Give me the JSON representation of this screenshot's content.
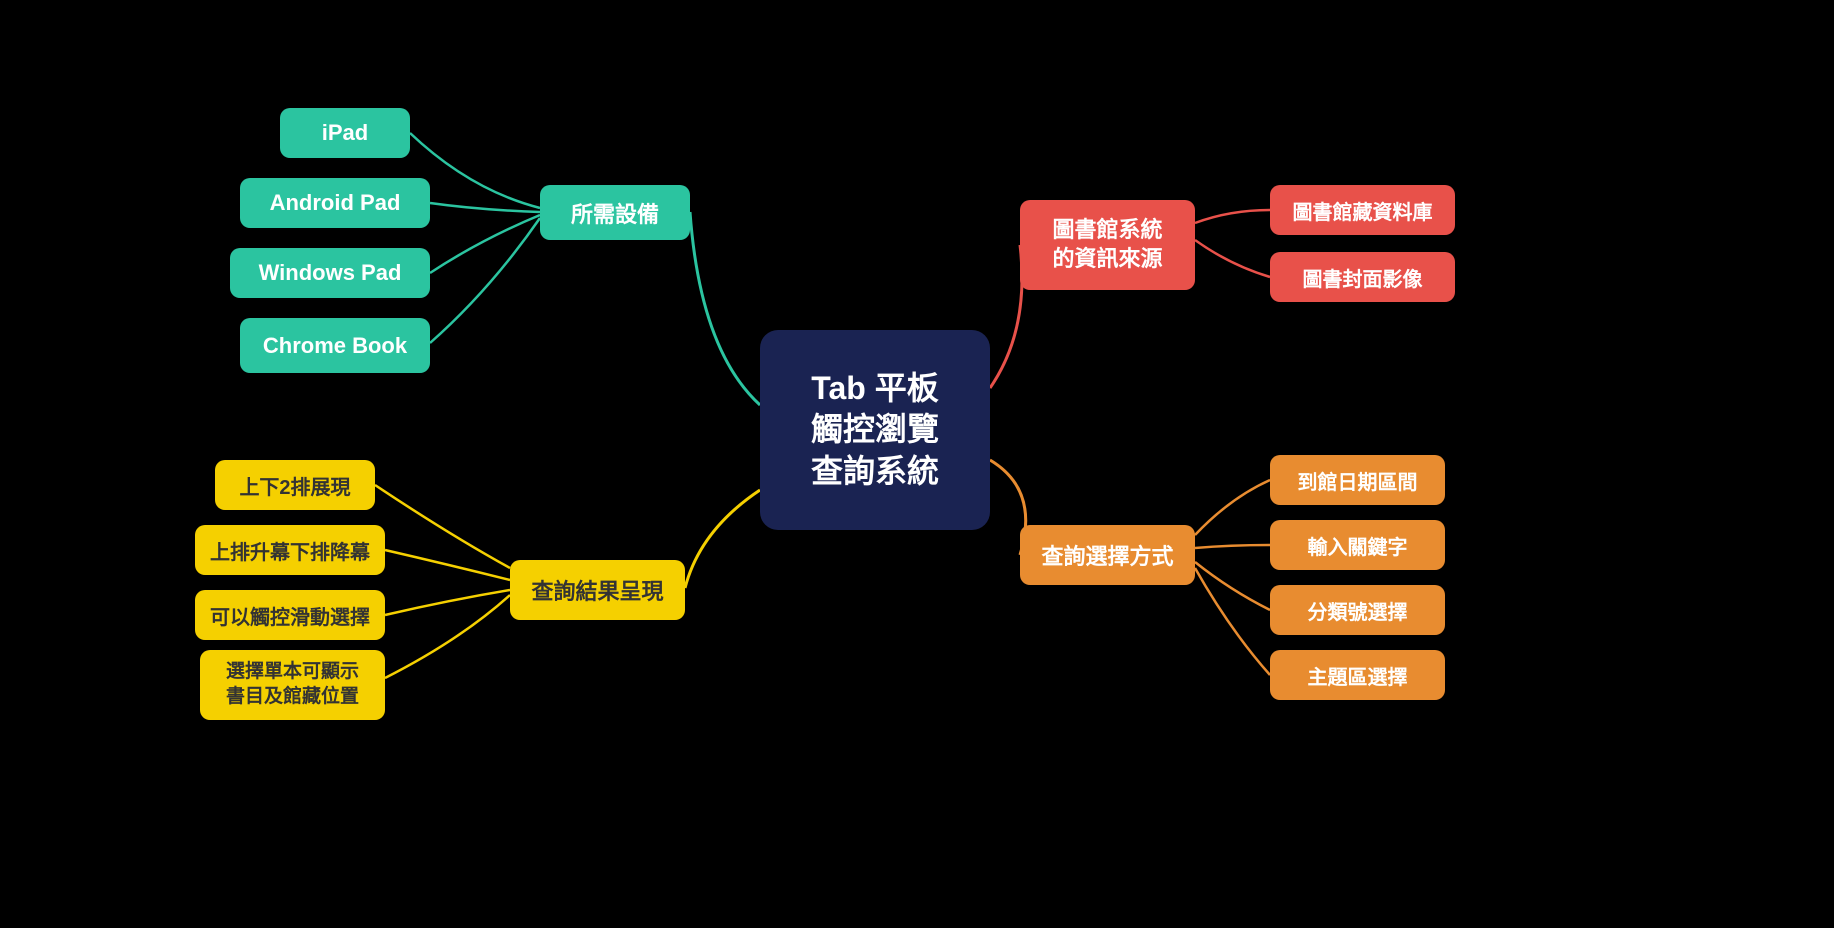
{
  "center": {
    "label": "Tab 平板\n觸控瀏覽\n查詢系統"
  },
  "left_top": {
    "branch_label": "所需設備",
    "items": [
      "iPad",
      "Android Pad",
      "Windows Pad",
      "Chrome Book"
    ]
  },
  "left_bottom": {
    "branch_label": "查詢結果呈現",
    "items": [
      "上下2排展現",
      "上排升幕下排降幕",
      "可以觸控滑動選擇",
      "選擇單本可顯示\n書目及館藏位置"
    ]
  },
  "right_top": {
    "branch_label": "圖書館系統\n的資訊來源",
    "items": [
      "圖書館藏資料庫",
      "圖書封面影像"
    ]
  },
  "right_bottom": {
    "branch_label": "查詢選擇方式",
    "items": [
      "到館日期區間",
      "輸入關鍵字",
      "分類號選擇",
      "主題區選擇"
    ]
  }
}
